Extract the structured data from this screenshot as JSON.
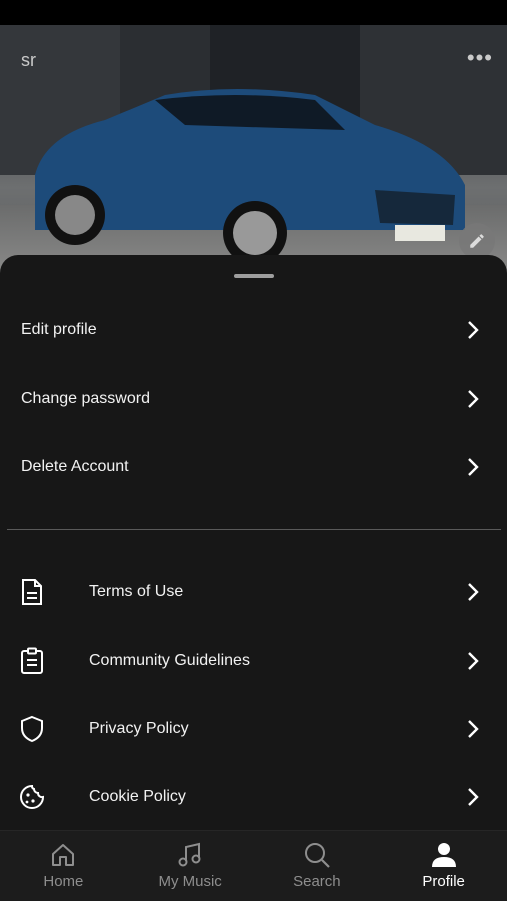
{
  "header": {
    "profile_name": "sr",
    "more_icon": "more-horizontal-icon",
    "edit_icon": "pencil-icon"
  },
  "account_menu": [
    {
      "label": "Edit profile"
    },
    {
      "label": "Change password"
    },
    {
      "label": "Delete Account"
    }
  ],
  "info_menu": [
    {
      "label": "Terms of Use",
      "icon": "document-icon"
    },
    {
      "label": "Community Guidelines",
      "icon": "clipboard-icon"
    },
    {
      "label": "Privacy Policy",
      "icon": "shield-icon"
    },
    {
      "label": "Cookie Policy",
      "icon": "cookie-icon"
    }
  ],
  "nav": {
    "items": [
      {
        "label": "Home",
        "icon": "home-icon"
      },
      {
        "label": "My Music",
        "icon": "music-note-icon"
      },
      {
        "label": "Search",
        "icon": "search-icon"
      },
      {
        "label": "Profile",
        "icon": "person-icon",
        "active": true
      }
    ]
  },
  "colors": {
    "sheet_bg": "#171717",
    "nav_bg": "#1c1c1c",
    "inactive_tab": "#8e8e8e",
    "active_tab": "#ffffff"
  }
}
